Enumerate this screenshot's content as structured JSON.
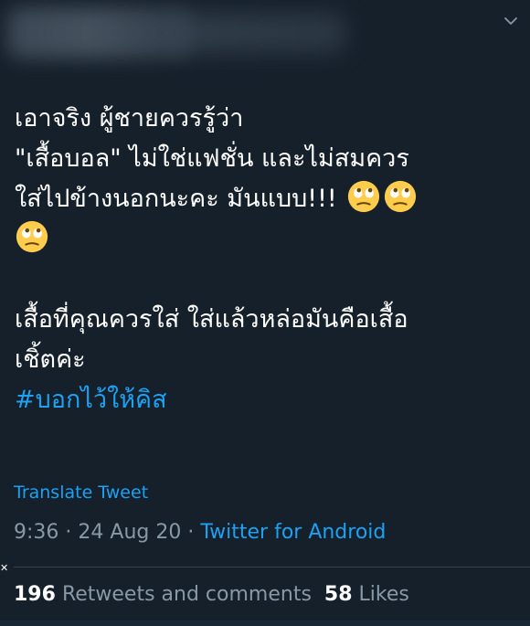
{
  "tweet": {
    "lines": [
      "เอาจริง ผู้ชายควรรู้ว่า",
      "\"เสื้อบอล\" ไม่ใช่แฟชั่น และไม่สมควร",
      "ใส่ไปข้างนอกนะคะ มันแบบ!!!",
      "เสื้อที่คุณควรใส่ ใส่แล้วหล่อมันคือเสื้อ",
      "เชิ้ตค่ะ"
    ],
    "hashtag": "#บอกไว้ให้คิส",
    "emoji_name": "face-with-rolling-eyes"
  },
  "translate": {
    "label": "Translate Tweet"
  },
  "meta": {
    "time": "9:36",
    "date": "24 Aug 20",
    "source": "Twitter for Android"
  },
  "stats": {
    "retweets_count": "196",
    "retweets_label": "Retweets and comments",
    "likes_count": "58",
    "likes_label": "Likes"
  },
  "colors": {
    "background": "#15202b",
    "text": "#ffffff",
    "secondary": "#8899a6",
    "accent": "#1da1f2",
    "divider": "#38444d"
  }
}
